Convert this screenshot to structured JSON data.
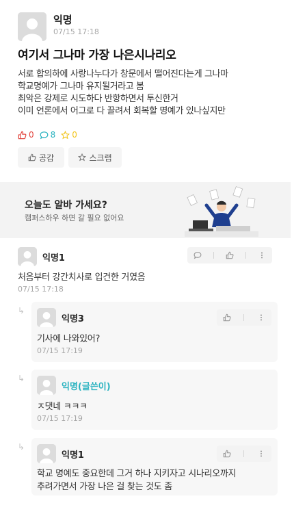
{
  "post": {
    "author": "익명",
    "time": "07/15 17:18",
    "title": "여기서 그나마 가장 나은시나리오",
    "body": [
      "서로 합의하에 사랑나누다가 창문에서 떨어진다는게 그나마",
      "학교명예가 그나마 유지될거라고 봄",
      "최악은 강제로 시도하다 반항하면서 투신한거",
      "이미 언론에서 어그로 다 끌려서 회복할 명예가 있나싶지만"
    ],
    "stats": {
      "likes": "0",
      "comments": "8",
      "scraps": "0"
    },
    "buttons": {
      "like": "공감",
      "scrap": "스크랩"
    }
  },
  "ad": {
    "title": "오늘도 알바 가세요?",
    "subtitle": "캠퍼스하우 하면 갈 필요 없어요"
  },
  "comments": [
    {
      "author": "익명1",
      "text": [
        "처음부터 강간치사로 입건한 거였음"
      ],
      "time": "07/15 17:18"
    },
    {
      "author": "익명3",
      "text": [
        "기사에 나와있어?"
      ],
      "time": "07/15 17:19",
      "reply": true
    },
    {
      "author": "익명(글쓴이)",
      "text": [
        "ㅈ댓네 ㅋㅋㅋ"
      ],
      "time": "07/15 17:19",
      "reply": true,
      "is_writer": true
    },
    {
      "author": "익명1",
      "text": [
        "학교 명예도 중요한데 그거 하나 지키자고 시나리오까지",
        "추려가면서 가장 나은 걸 찾는 것도 좀"
      ],
      "reply": true
    }
  ],
  "colors": {
    "like": "#e2463f",
    "comment": "#2bb3c0",
    "scrap": "#f2c51d",
    "writer": "#2bb3c0"
  }
}
